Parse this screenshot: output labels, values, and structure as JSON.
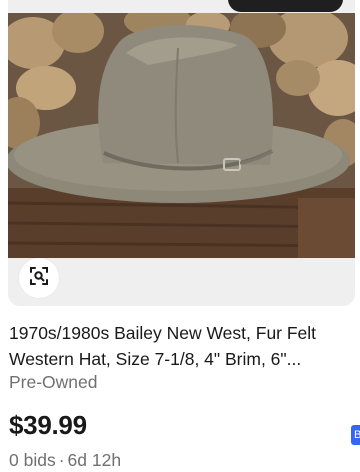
{
  "listing": {
    "title_line1": "1970s/1980s Bailey New West, Fur Felt",
    "title_line2": "Western Hat, Size 7-1/8, 4\" Brim, 6\"...",
    "condition": "Pre-Owned",
    "price": "$39.99",
    "bids": "0 bids",
    "separator": "·",
    "time_left": "6d 12h",
    "image_alt": "Grey fur felt western cowboy hat on rocks"
  },
  "icons": {
    "visual_search": "visual-search-icon"
  },
  "edge_badge": {
    "label": "B"
  },
  "colors": {
    "title": "#191919",
    "secondary_text": "#707070",
    "price": "#191919",
    "accent": "#3665f3"
  }
}
